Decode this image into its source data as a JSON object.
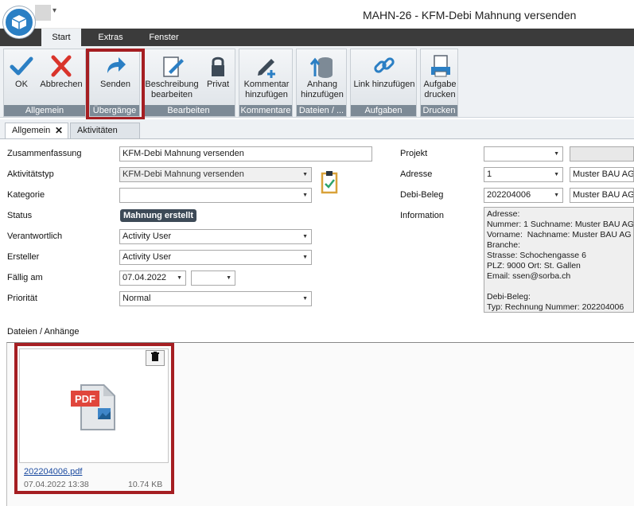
{
  "window": {
    "title": "MAHN-26 - KFM-Debi Mahnung versenden",
    "qat_arrow": "▾"
  },
  "ribbon_tabs": [
    "Start",
    "Extras",
    "Fenster"
  ],
  "ribbon": {
    "groups": [
      "Allgemein",
      "Übergänge",
      "Bearbeiten",
      "Kommentare",
      "Dateien / ...",
      "Aufgaben",
      "Drucken"
    ],
    "buttons": {
      "ok": "OK",
      "cancel": "Abbrechen",
      "send": "Senden",
      "edit_desc_1": "Beschreibung",
      "edit_desc_2": "bearbeiten",
      "private": "Privat",
      "comment_1": "Kommentar",
      "comment_2": "hinzufügen",
      "attach_1": "Anhang",
      "attach_2": "hinzufügen",
      "link": "Link hinzufügen",
      "print_1": "Aufgabe",
      "print_2": "drucken"
    },
    "colors": {
      "ok": "#2b7fc4",
      "cancel": "#d9342b",
      "highlight": "#a51e22"
    }
  },
  "doc_tabs": [
    "Allgemein",
    "Aktivitäten"
  ],
  "doc_tab_close": "✕",
  "form": {
    "labels": {
      "summary": "Zusammenfassung",
      "type": "Aktivitätstyp",
      "category": "Kategorie",
      "status": "Status",
      "responsible": "Verantwortlich",
      "creator": "Ersteller",
      "due": "Fällig am",
      "priority": "Priorität",
      "project": "Projekt",
      "address": "Adresse",
      "debi": "Debi-Beleg",
      "information": "Information"
    },
    "values": {
      "summary": "KFM-Debi Mahnung versenden",
      "type": "KFM-Debi Mahnung versenden",
      "category": "",
      "status": "Mahnung erstellt",
      "responsible": "Activity User",
      "creator": "Activity User",
      "due_date": "07.04.2022",
      "due_time": "",
      "priority": "Normal",
      "project": "",
      "project_extra": "",
      "address": "1",
      "address_name": "Muster BAU AG",
      "debi": "202204006",
      "debi_name": "Muster BAU AG",
      "information": "Adresse:\nNummer: 1 Suchname: Muster BAU AG\nVorname:  Nachname: Muster BAU AG\nBranche:\nStrasse: Schochengasse 6\nPLZ: 9000 Ort: St. Gallen\nEmail: ssen@sorba.ch\n\nDebi-Beleg:\nTyp: Rechnung Nummer: 202204006"
    }
  },
  "attachments": {
    "section_label": "Dateien / Anhänge",
    "files": [
      {
        "name": "202204006.pdf",
        "date": "07.04.2022 13:38",
        "size": "10.74 KB",
        "badge": "PDF"
      }
    ]
  }
}
